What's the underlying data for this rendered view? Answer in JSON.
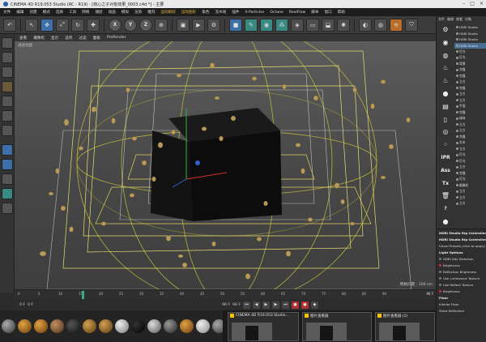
{
  "window": {
    "title": "CINEMA 4D R19.053 Studio (RC - R19) - [核心之子对象效果_0003.c4d *] - 主要"
  },
  "menu": [
    "文件",
    "编辑",
    "创建",
    "模式",
    "选择",
    "工具",
    "网格",
    "捕捉",
    "动画",
    "模拟",
    "渲染",
    "雕刻",
    "运动跟踪",
    "运动图形",
    "角色",
    "流水线",
    "插件",
    "X-Particles",
    "Octane",
    "RealFlow",
    "脚本",
    "窗口",
    "帮助"
  ],
  "toolbar": {
    "icons": [
      "undo-icon",
      "cursor-icon",
      "move-icon",
      "scale-icon",
      "rotate-icon",
      "x-axis",
      "y-axis",
      "z-axis",
      "coord-icon",
      "render-region-icon",
      "render-view-icon",
      "render-settings-icon",
      "cube-icon",
      "pen-icon",
      "subdivision-icon",
      "array-icon",
      "deformer-icon",
      "floor-icon",
      "camera-icon",
      "light-icon"
    ],
    "axes": [
      "X",
      "Y",
      "Z"
    ]
  },
  "viewport": {
    "menu": [
      "查看",
      "摄像机",
      "显示",
      "选项",
      "过滤",
      "面板",
      "ProRender"
    ],
    "label": "透视视图",
    "grid_label": "网格间距 : 100 cm"
  },
  "timeline": {
    "ticks": [
      "0",
      "5",
      "10",
      "15",
      "20",
      "25",
      "30",
      "35",
      "40",
      "45",
      "50",
      "55",
      "60",
      "65",
      "70",
      "75",
      "80",
      "85",
      "90"
    ],
    "end_label": "96 F"
  },
  "transport": {
    "start": "0 F",
    "current": "0 F",
    "end": "96 F",
    "end2": "96 F"
  },
  "taskbar": {
    "tasks": [
      {
        "title": "CINEMA 4D R19.053 Studio..."
      },
      {
        "title": "图片查看器"
      },
      {
        "title": "图片查看器 (2)"
      }
    ]
  },
  "object_manager": {
    "tabs": [
      "文件",
      "编辑",
      "查看",
      "对象"
    ],
    "items": [
      "HDRI Studio",
      "HDRI Studio",
      "HDRI Studio",
      "HDRI Studio",
      "灯光",
      "灯光",
      "背景",
      "克隆",
      "克隆",
      "立方",
      "克隆",
      "立方",
      "立方",
      "平面",
      "克隆",
      "球体",
      "立方",
      "立方",
      "克隆",
      "文本",
      "立方",
      "灯光",
      "灯光",
      "立方",
      "克隆",
      "灯光",
      "摄像机",
      "立方",
      "立方",
      "立方"
    ],
    "icons": [
      "gear-icon",
      "eye-icon",
      "globe-icon",
      "lightbulb-icon",
      "lightbulb-icon",
      "sphere-icon",
      "panel-icon",
      "file-icon",
      "octane-icon",
      "dots-icon",
      "IPR",
      "Ass",
      "Tx",
      "trash-icon",
      "?",
      "sphere-icon"
    ]
  },
  "attributes": {
    "title": "HDRI Studio Rig Controller",
    "rows": [
      {
        "label": "HDRI Studio Rig Controller",
        "header": true
      },
      {
        "label": "Visual Presets (click to apply)"
      },
      {
        "label": "Light Options",
        "header": true
      },
      {
        "label": "HDRI Alts Selection",
        "on": false
      },
      {
        "label": "Brightness",
        "on": true
      },
      {
        "label": "Reflection Brightness",
        "on": false
      },
      {
        "label": "Use Luminance Texture",
        "on": false
      },
      {
        "label": "Use Reflect Texture",
        "on": false
      },
      {
        "label": "Brightness",
        "on": true
      },
      {
        "label": "Floor",
        "header": true
      },
      {
        "label": "Infinite Floor"
      },
      {
        "label": "Show Reflection"
      }
    ]
  }
}
